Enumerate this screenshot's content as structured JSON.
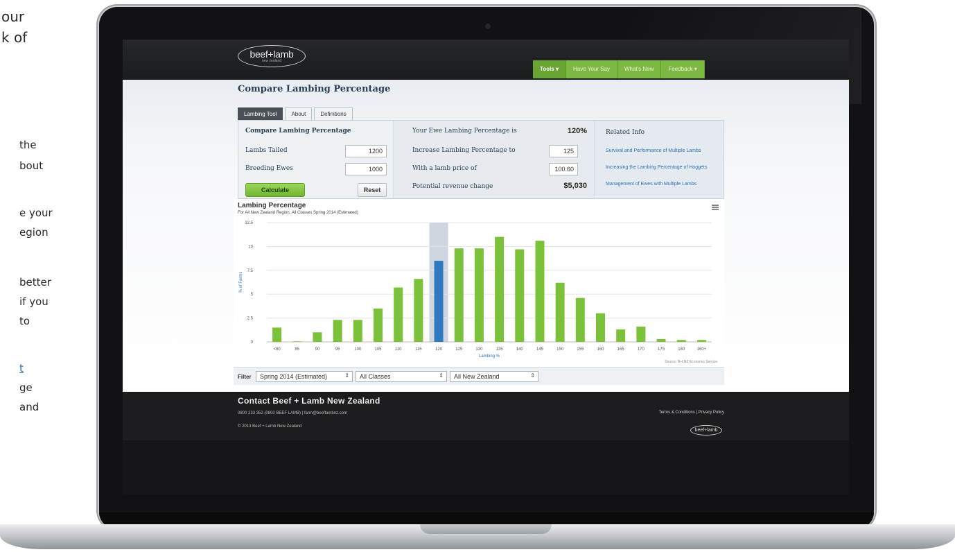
{
  "side_text": [
    "our",
    "k of",
    "the",
    "bout",
    "e your",
    "egion",
    "better",
    "if you",
    "to",
    "t",
    "ge",
    "and"
  ],
  "header": {
    "logo_main": "beef+lamb",
    "logo_sub": "new zealand",
    "nav": [
      "Tools",
      "Have Your Say",
      "What's New",
      "Feedback"
    ]
  },
  "page_title": "Compare Lambing Percentage",
  "tabs": [
    "Lambing Tool",
    "About",
    "Definitions"
  ],
  "calculator": {
    "heading": "Compare Lambing Percentage",
    "lambs_tailed_label": "Lambs Tailed",
    "lambs_tailed_value": "1200",
    "breeding_ewes_label": "Breeding Ewes",
    "breeding_ewes_value": "1000",
    "calculate_label": "Calculate",
    "reset_label": "Reset"
  },
  "results": {
    "ewe_pct_label": "Your Ewe Lambing Percentage is",
    "ewe_pct_value": "120%",
    "increase_label": "Increase Lambing Percentage to",
    "increase_value": "125",
    "price_label": "With a lamb price of",
    "price_value": "100.60",
    "revenue_label": "Potential revenue change",
    "revenue_value": "$5,030"
  },
  "related": {
    "heading": "Related Info",
    "links": [
      "Survival and Performance of Multiple Lambs",
      "Increasing the Lambing Percentage of Hoggets",
      "Management of Ewes with Multiple Lambs"
    ]
  },
  "chart_data": {
    "type": "bar",
    "title": "Lambing Percentage",
    "subtitle": "For All New Zealand Region, All Classes Spring 2014 (Estimated)",
    "xlabel": "Lambing %",
    "ylabel": "% of Farms",
    "source": "Source: B+LNZ Economic Service",
    "categories": [
      "<80",
      "85",
      "90",
      "95",
      "100",
      "105",
      "110",
      "115",
      "120",
      "125",
      "130",
      "135",
      "140",
      "145",
      "150",
      "155",
      "160",
      "165",
      "170",
      "175",
      "180",
      "160+"
    ],
    "values": [
      1.5,
      0.05,
      1.0,
      2.3,
      2.3,
      3.5,
      5.7,
      6.6,
      8.5,
      9.8,
      9.8,
      11.0,
      9.7,
      10.6,
      6.2,
      4.6,
      3.0,
      1.3,
      1.6,
      0.3,
      0.2,
      0.2
    ],
    "highlight_category": "120",
    "ylim": [
      0,
      12.5
    ],
    "yticks": [
      0,
      2.5,
      5,
      7.5,
      10,
      12.5
    ],
    "bar_color": "#7cc13a",
    "highlight_color": "#2f79c1",
    "highlight_band_color": "#cfd6e0",
    "grid": true
  },
  "filter": {
    "label": "Filter",
    "season": "Spring 2014 (Estimated)",
    "class": "All Classes",
    "region": "All New Zealand"
  },
  "footer": {
    "title": "Contact Beef + Lamb New Zealand",
    "contact": "0800 233 352 (0800 BEEF LAMB) | farm@beeflambnz.com",
    "copyright": "© 2013 Beef + Lamb New Zealand",
    "terms": "Terms & Conditions",
    "privacy": "Privacy Policy",
    "logo": "beef+lamb"
  }
}
